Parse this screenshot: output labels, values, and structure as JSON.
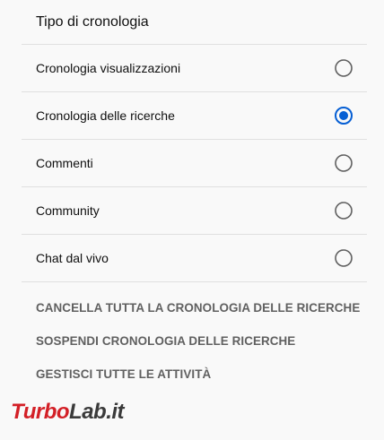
{
  "section": {
    "title": "Tipo di cronologia"
  },
  "options": [
    {
      "label": "Cronologia visualizzazioni",
      "selected": false
    },
    {
      "label": "Cronologia delle ricerche",
      "selected": true
    },
    {
      "label": "Commenti",
      "selected": false
    },
    {
      "label": "Community",
      "selected": false
    },
    {
      "label": "Chat dal vivo",
      "selected": false
    }
  ],
  "actions": [
    {
      "label": "CANCELLA TUTTA LA CRONOLOGIA DELLE RICERCHE"
    },
    {
      "label": "SOSPENDI CRONOLOGIA DELLE RICERCHE"
    },
    {
      "label": "GESTISCI TUTTE LE ATTIVITÀ"
    }
  ],
  "watermark": {
    "part1": "Turbo",
    "part2": "Lab.it"
  },
  "colors": {
    "background": "#f9f9f9",
    "divider": "#e0e0e0",
    "text": "#0f0f0f",
    "action_text": "#606060",
    "radio_selected": "#065fd4",
    "radio_unselected": "#606060",
    "watermark_red": "#d31f26",
    "watermark_grey": "#3a3a3a"
  }
}
